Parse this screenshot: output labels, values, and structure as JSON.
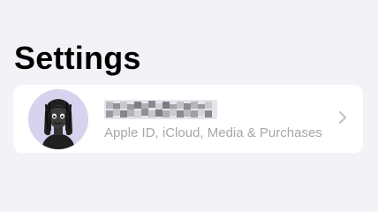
{
  "header": {
    "title": "Settings"
  },
  "account": {
    "subtitle": "Apple ID, iCloud, Media & Purchases",
    "name_redacted": true,
    "avatar": "memoji-avatar",
    "chevron": "chevron-right-icon"
  },
  "colors": {
    "background": "#f2f2f7",
    "card": "#ffffff",
    "avatar_background": "#d8d2ef",
    "secondary_text": "#a7a7ab",
    "chevron": "#c4c4c7"
  }
}
